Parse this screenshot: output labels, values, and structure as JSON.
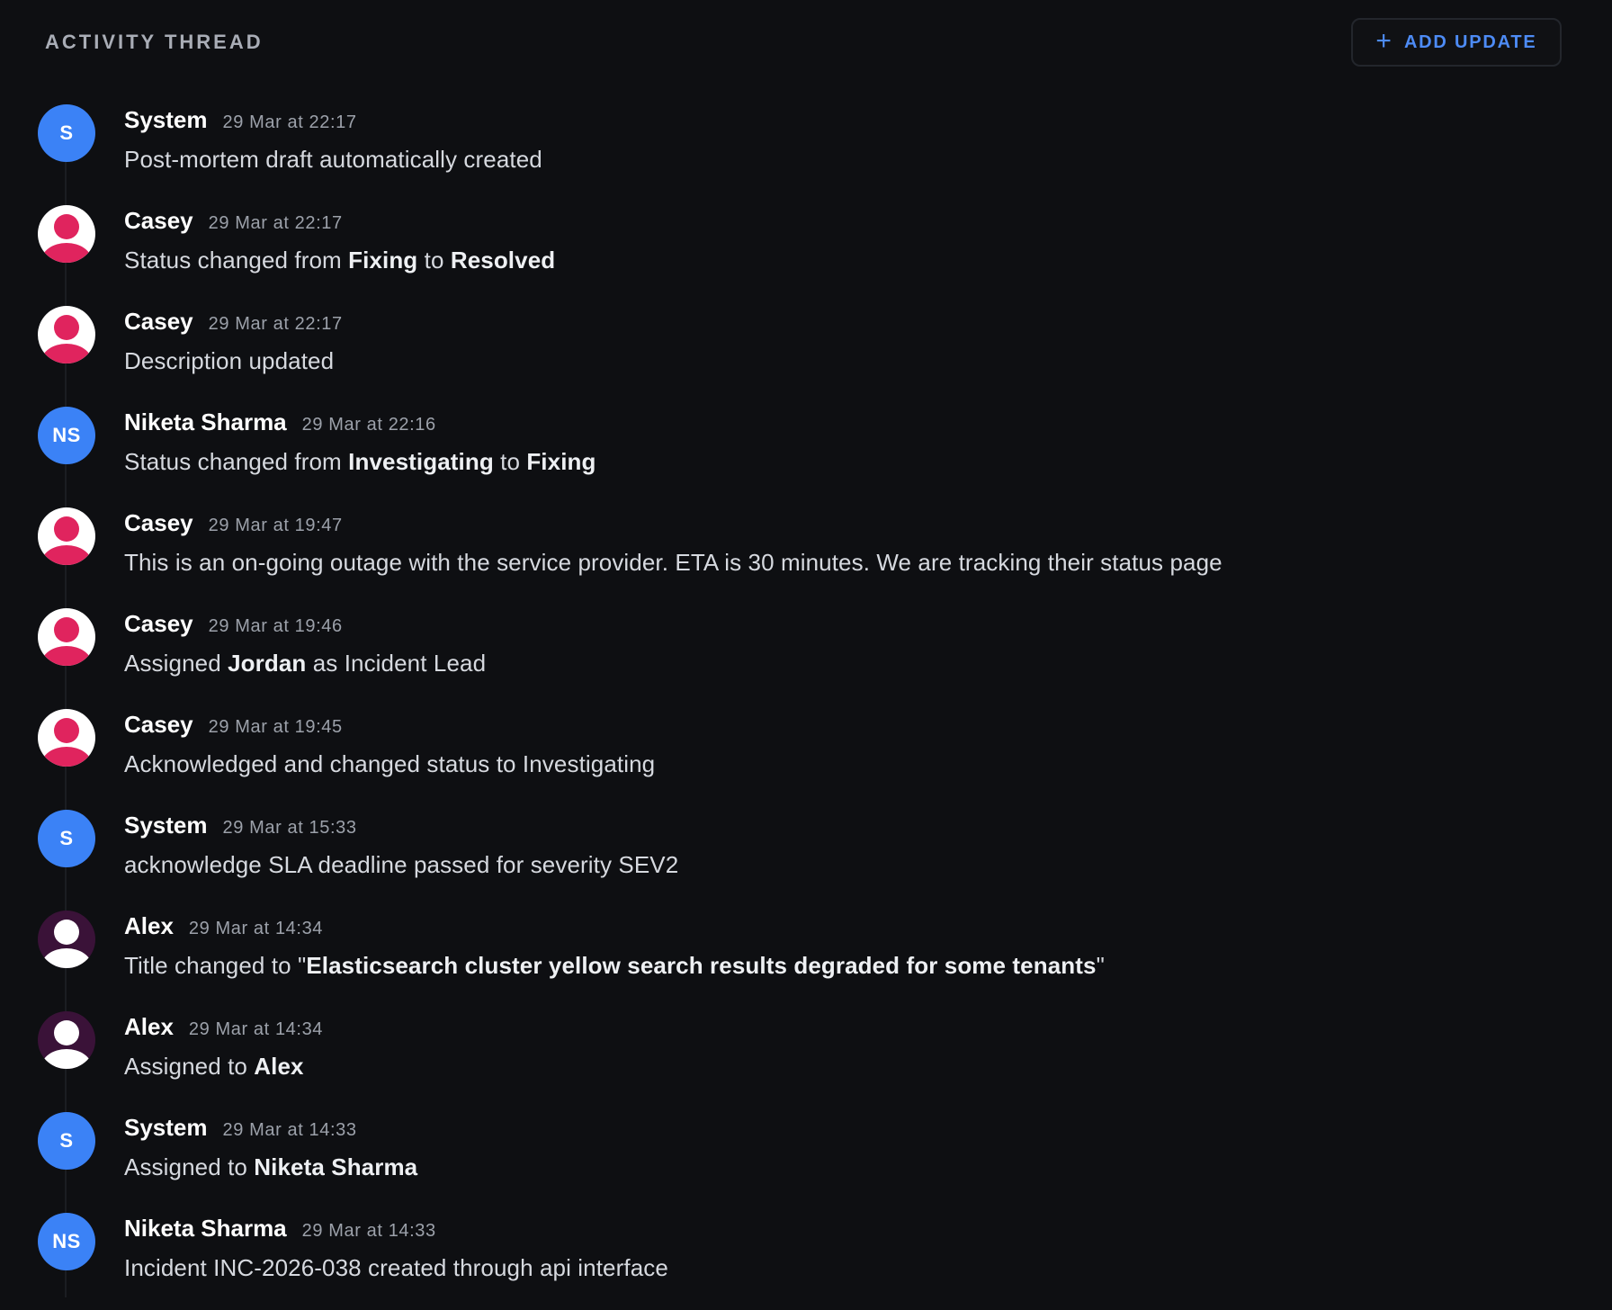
{
  "header": {
    "title": "ACTIVITY THREAD",
    "add_button_label": "ADD UPDATE",
    "add_button_icon": "plus-icon"
  },
  "colors": {
    "background": "#0e0f12",
    "accent": "#4d8bf5",
    "initials_avatar": "#3b82f6",
    "casey_avatar": "#e0245e",
    "alex_avatar": "#3a1238"
  },
  "entries": [
    {
      "author": "System",
      "time": "29 Mar at 22:17",
      "avatar": {
        "type": "initials",
        "text": "S"
      },
      "message": [
        {
          "text": "Post-mortem draft automatically created"
        }
      ]
    },
    {
      "author": "Casey",
      "time": "29 Mar at 22:17",
      "avatar": {
        "type": "person",
        "style": "casey"
      },
      "message": [
        {
          "text": "Status changed from "
        },
        {
          "text": "Fixing",
          "bold": true
        },
        {
          "text": " to "
        },
        {
          "text": "Resolved",
          "bold": true
        }
      ]
    },
    {
      "author": "Casey",
      "time": "29 Mar at 22:17",
      "avatar": {
        "type": "person",
        "style": "casey"
      },
      "message": [
        {
          "text": "Description updated"
        }
      ]
    },
    {
      "author": "Niketa Sharma",
      "time": "29 Mar at 22:16",
      "avatar": {
        "type": "initials",
        "text": "NS"
      },
      "message": [
        {
          "text": "Status changed from "
        },
        {
          "text": "Investigating",
          "bold": true
        },
        {
          "text": " to "
        },
        {
          "text": "Fixing",
          "bold": true
        }
      ]
    },
    {
      "author": "Casey",
      "time": "29 Mar at 19:47",
      "avatar": {
        "type": "person",
        "style": "casey"
      },
      "message": [
        {
          "text": "This is an on-going outage with the service provider. ETA is 30 minutes. We are tracking their status page"
        }
      ]
    },
    {
      "author": "Casey",
      "time": "29 Mar at 19:46",
      "avatar": {
        "type": "person",
        "style": "casey"
      },
      "message": [
        {
          "text": "Assigned "
        },
        {
          "text": "Jordan",
          "bold": true
        },
        {
          "text": " as Incident Lead"
        }
      ]
    },
    {
      "author": "Casey",
      "time": "29 Mar at 19:45",
      "avatar": {
        "type": "person",
        "style": "casey"
      },
      "message": [
        {
          "text": "Acknowledged and changed status to Investigating"
        }
      ]
    },
    {
      "author": "System",
      "time": "29 Mar at 15:33",
      "avatar": {
        "type": "initials",
        "text": "S"
      },
      "message": [
        {
          "text": "acknowledge SLA deadline passed for severity SEV2"
        }
      ]
    },
    {
      "author": "Alex",
      "time": "29 Mar at 14:34",
      "avatar": {
        "type": "person",
        "style": "alex"
      },
      "message": [
        {
          "text": "Title changed to \""
        },
        {
          "text": "Elasticsearch cluster yellow search results degraded for some tenants",
          "bold": true
        },
        {
          "text": "\""
        }
      ]
    },
    {
      "author": "Alex",
      "time": "29 Mar at 14:34",
      "avatar": {
        "type": "person",
        "style": "alex"
      },
      "message": [
        {
          "text": "Assigned to "
        },
        {
          "text": "Alex",
          "bold": true
        }
      ]
    },
    {
      "author": "System",
      "time": "29 Mar at 14:33",
      "avatar": {
        "type": "initials",
        "text": "S"
      },
      "message": [
        {
          "text": "Assigned to "
        },
        {
          "text": "Niketa Sharma",
          "bold": true
        }
      ]
    },
    {
      "author": "Niketa Sharma",
      "time": "29 Mar at 14:33",
      "avatar": {
        "type": "initials",
        "text": "NS"
      },
      "message": [
        {
          "text": "Incident INC-2026-038 created through api interface"
        }
      ]
    }
  ]
}
